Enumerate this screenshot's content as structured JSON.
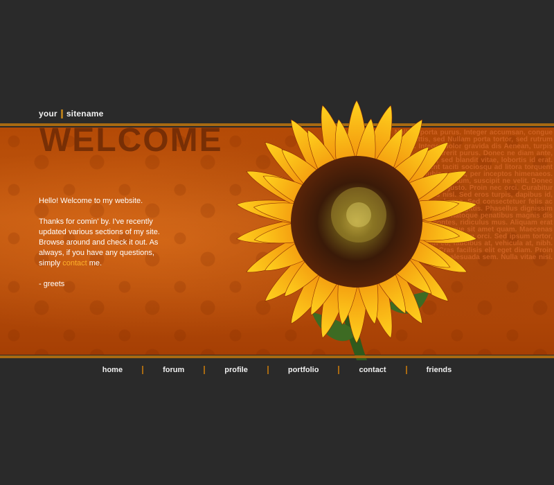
{
  "header": {
    "site_first": "your",
    "site_second": "sitename"
  },
  "banner": {
    "welcome": "WELCOME",
    "greeting": "Hello! Welcome to my website.",
    "body_before_link": "Thanks for comin' by. I've recently updated various sections of my site. Browse around and check it out. As always, if you have any questions, simply",
    "contact_link": "contact",
    "body_after_link": "me.",
    "signoff": "- greets",
    "lorem_text": "Nullam porta purus. Integer accumsan, congue sagittis, sed Nullam porta tortor, sed rutrum urna. Integer dolor gravida dis Aenean, turpis nisi, sed hedrerit purus. Donec ne diam ante, vulputate, sed blandit vitae, lobortis id erat. Class aptent taciti sociosqu ad litora torquent per conubia nostra, per inceptos himenaeos. Suspendisse dictum, suscipit ne velit. Donec pulvinar dui justo. Proin nec orci. Curabitur semer lobortis nisl. Sed eros turpis, dapibus id, blandit a, sed eros. Sed consectetuer felis ac nisi. Sed suscipit sagittis. Phasellus dignissim velit. Cum sociis natoque penatibus magnis dis parturient montes, ridiculus mus. Aliquam erat volutpat. Quisque sit amet quam. Maecenas masuda. Nam ipsum orci. Sed ipsum tortor, sollicitudin eu, faucibus at, vehicula at, nibh. Nulla facilisi. Cras facilisis elit eget diam. Proin dictum malesuada sem. Nulla vitae nisi."
  },
  "nav": {
    "items": [
      "home",
      "forum",
      "profile",
      "portfolio",
      "contact",
      "friends"
    ]
  },
  "colors": {
    "background": "#2a2a2a",
    "banner": "#b44a06",
    "accent_line": "#a86a12",
    "link": "#ffb12a"
  },
  "icons": {
    "flower": "sunflower-image"
  }
}
